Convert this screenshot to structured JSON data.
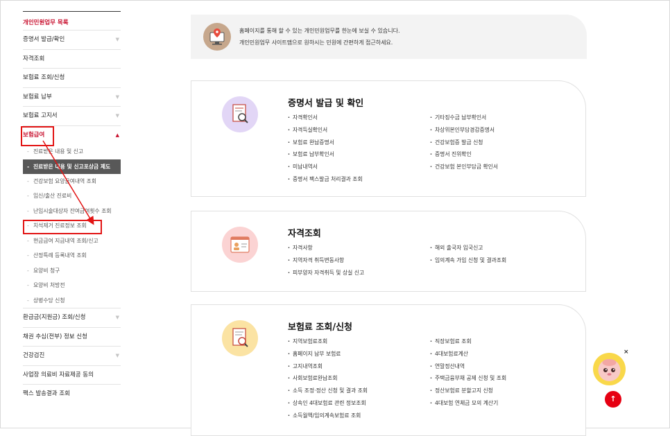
{
  "sidebar": {
    "heading": "개인민원업무 목록",
    "items_before": [
      {
        "label": "증명서 발급/확인",
        "has_arrow": true
      },
      {
        "label": "자격조회",
        "has_arrow": false
      },
      {
        "label": "보험료 조회/신청",
        "has_arrow": false
      },
      {
        "label": "보험료 납부",
        "has_arrow": true
      },
      {
        "label": "보험료 고지서",
        "has_arrow": true
      }
    ],
    "active_item": {
      "label": "보험급여",
      "arrow": "▲"
    },
    "sub_items": [
      "진료받은 내용 및 신고",
      "진료받은 내용 및 신고포상금 제도",
      "건강보험 요양급여내역 조회",
      "임신/출산 진료비",
      "난임시술대상자 잔여급여횟수 조회",
      "치석제거 진료정보 조회",
      "현금급여 지급내역 조회/신고",
      "산정특례 등록내역 조회",
      "요양비 청구",
      "요양비 처방전",
      "상병수당 신청"
    ],
    "selected_sub_index": 1,
    "items_after": [
      {
        "label": "환급금(지원금) 조회/신청",
        "has_arrow": true
      },
      {
        "label": "채권 추심(전부) 정보 신청",
        "has_arrow": false
      },
      {
        "label": "건강검진",
        "has_arrow": true
      },
      {
        "label": "사업장 의료비 자료제공 동의",
        "has_arrow": false
      },
      {
        "label": "팩스 발송결과 조회",
        "has_arrow": false
      }
    ],
    "arrow_glyph": "▼"
  },
  "banner": {
    "line1": "홈페이지를 통해 할 수 있는 개인민원업무를 한눈에 보실 수 있습니다.",
    "line2": "개인민원업무 사이트맵으로 원하시는 민원에 간편하게 접근하세요.",
    "icon": "monitor-location-icon"
  },
  "cards": [
    {
      "title": "증명서 발급 및 확인",
      "icon": "certificate-search-icon",
      "color": "#e2d6f6",
      "left": [
        "자격확인서",
        "자격득실확인서",
        "보험료 완납증명서",
        "보험료 납부확인서",
        "미납내역서",
        "증명서 팩스발급 처리결과 조회"
      ],
      "right": [
        "기타징수금 납부확인서",
        "차상위본인부담경감증명서",
        "건강보험증 발급 신청",
        "증명서 진위확인",
        "건강보험 본인부담금 확인서"
      ]
    },
    {
      "title": "자격조회",
      "icon": "id-card-icon",
      "color": "#fbd3d3",
      "left": [
        "자격사항",
        "지역자격 취득변동사항",
        "피부양자 자격취득 및 상실 신고"
      ],
      "right": [
        "해외 출국자 입국신고",
        "임의계속 가입 신청 및 결과조회"
      ]
    },
    {
      "title": "보험료 조회/신청",
      "icon": "document-search-icon",
      "color": "#fbe3a3",
      "left": [
        "지역보험료조회",
        "홈페이지 납부 보험료",
        "고지내역조회",
        "사회보험료완납조회",
        "소득 조정·정산 신청 및 결과 조회",
        "상속인 4대보험료 관련 정보조회",
        "소득월액/임의계속보험료 조회"
      ],
      "right": [
        "직장보험료 조회",
        "4대보험료계산",
        "연말정산내역",
        "주택금융부채 공제 신청 및 조회",
        "정산보험료 분할고지 신청",
        "4대보험 연체금 모의 계산기"
      ]
    }
  ],
  "widgets": {
    "close": "×",
    "top_arrow": "↑",
    "mascot_icon": "chatbot-mascot-icon"
  }
}
